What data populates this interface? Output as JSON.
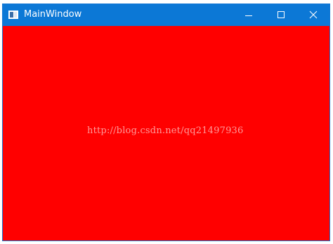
{
  "window": {
    "title": "MainWindow",
    "titlebar_color": "#0c78d6",
    "client_color": "#ff0000",
    "controls": {
      "minimize_icon": "minimize-icon",
      "maximize_icon": "maximize-icon",
      "close_icon": "close-icon"
    }
  },
  "watermark": {
    "text": "http://blog.csdn.net/qq21497936"
  }
}
